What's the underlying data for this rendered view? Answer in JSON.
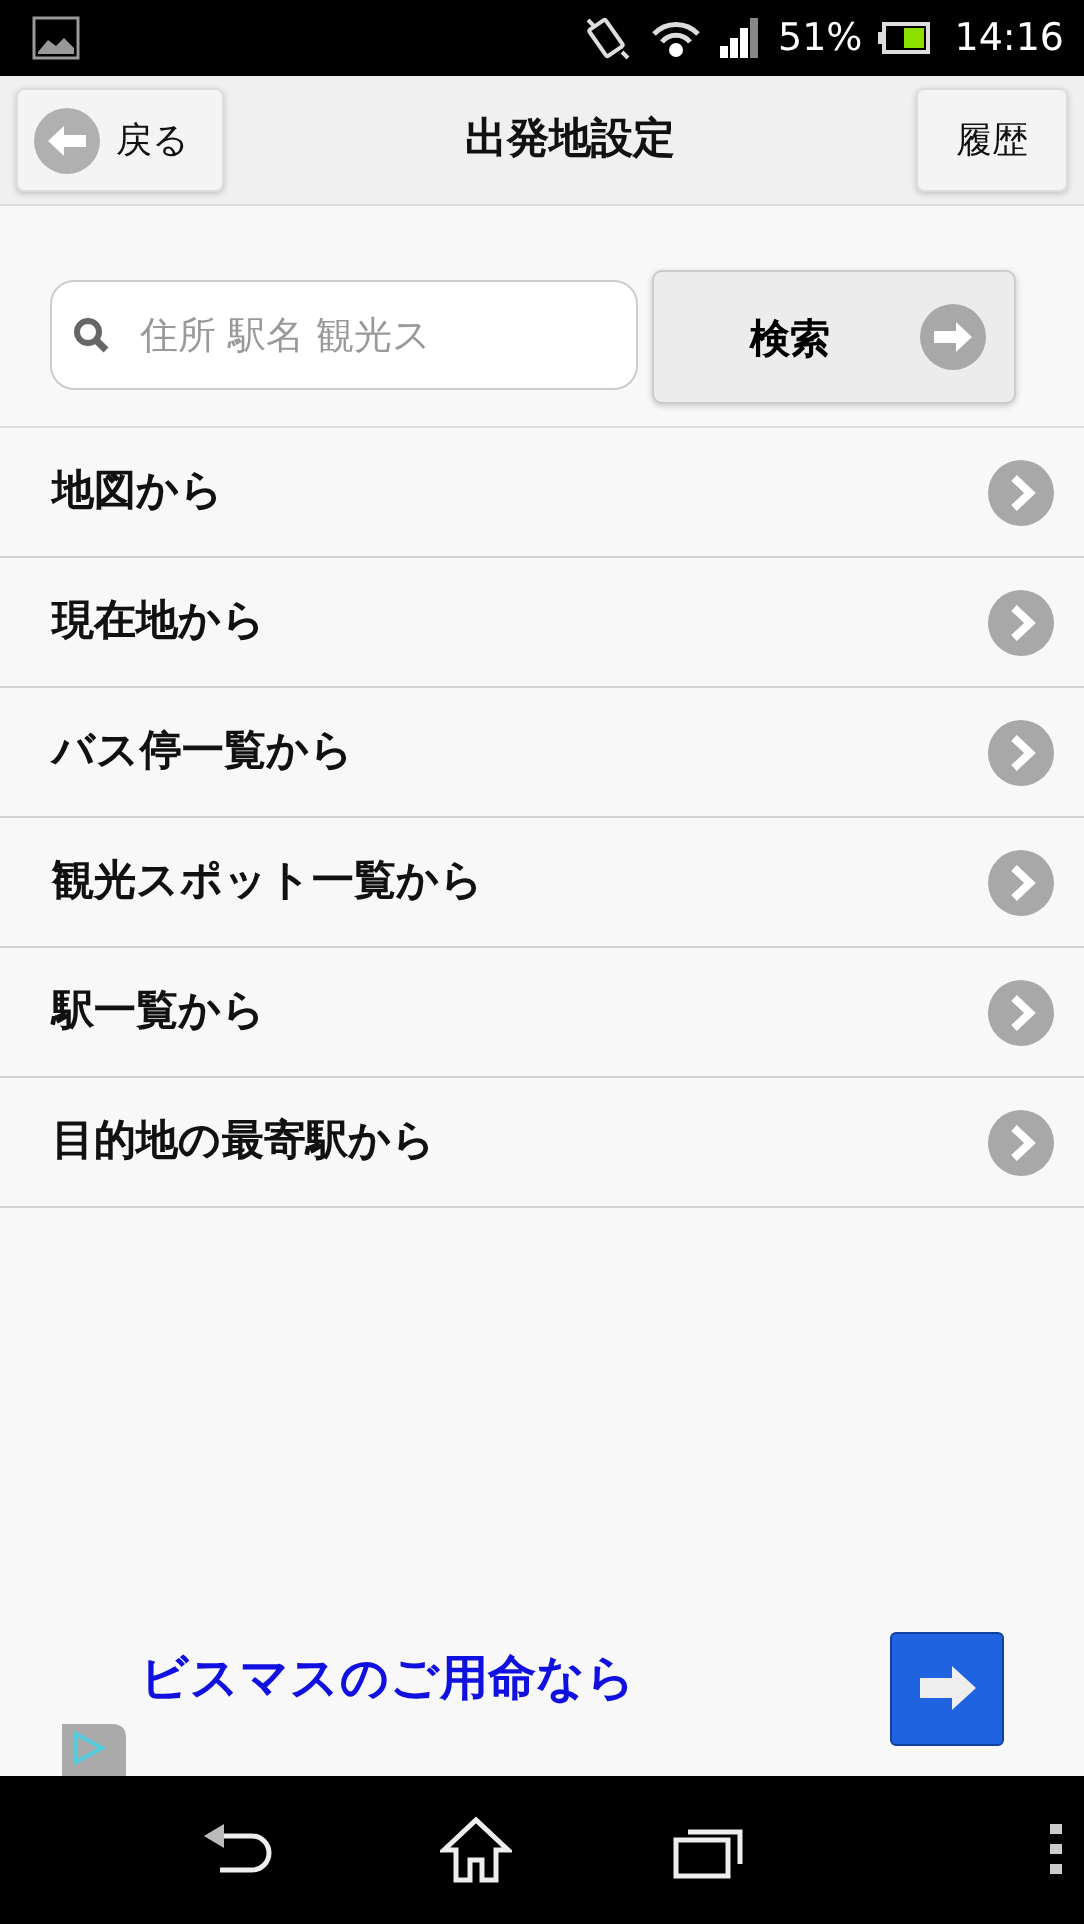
{
  "status_bar": {
    "battery": "51%",
    "time": "14:16"
  },
  "header": {
    "back_button": "戻る",
    "title": "出発地設定",
    "history_button": "履歴"
  },
  "search": {
    "placeholder": "住所 駅名 観光ス",
    "button": "検索"
  },
  "menu": [
    {
      "label": "地図から"
    },
    {
      "label": "現在地から"
    },
    {
      "label": "バス停一覧から"
    },
    {
      "label": "観光スポット一覧から"
    },
    {
      "label": "駅一覧から"
    },
    {
      "label": "目的地の最寄駅から"
    }
  ],
  "ad": {
    "text": "ビスマスのご用命なら"
  }
}
